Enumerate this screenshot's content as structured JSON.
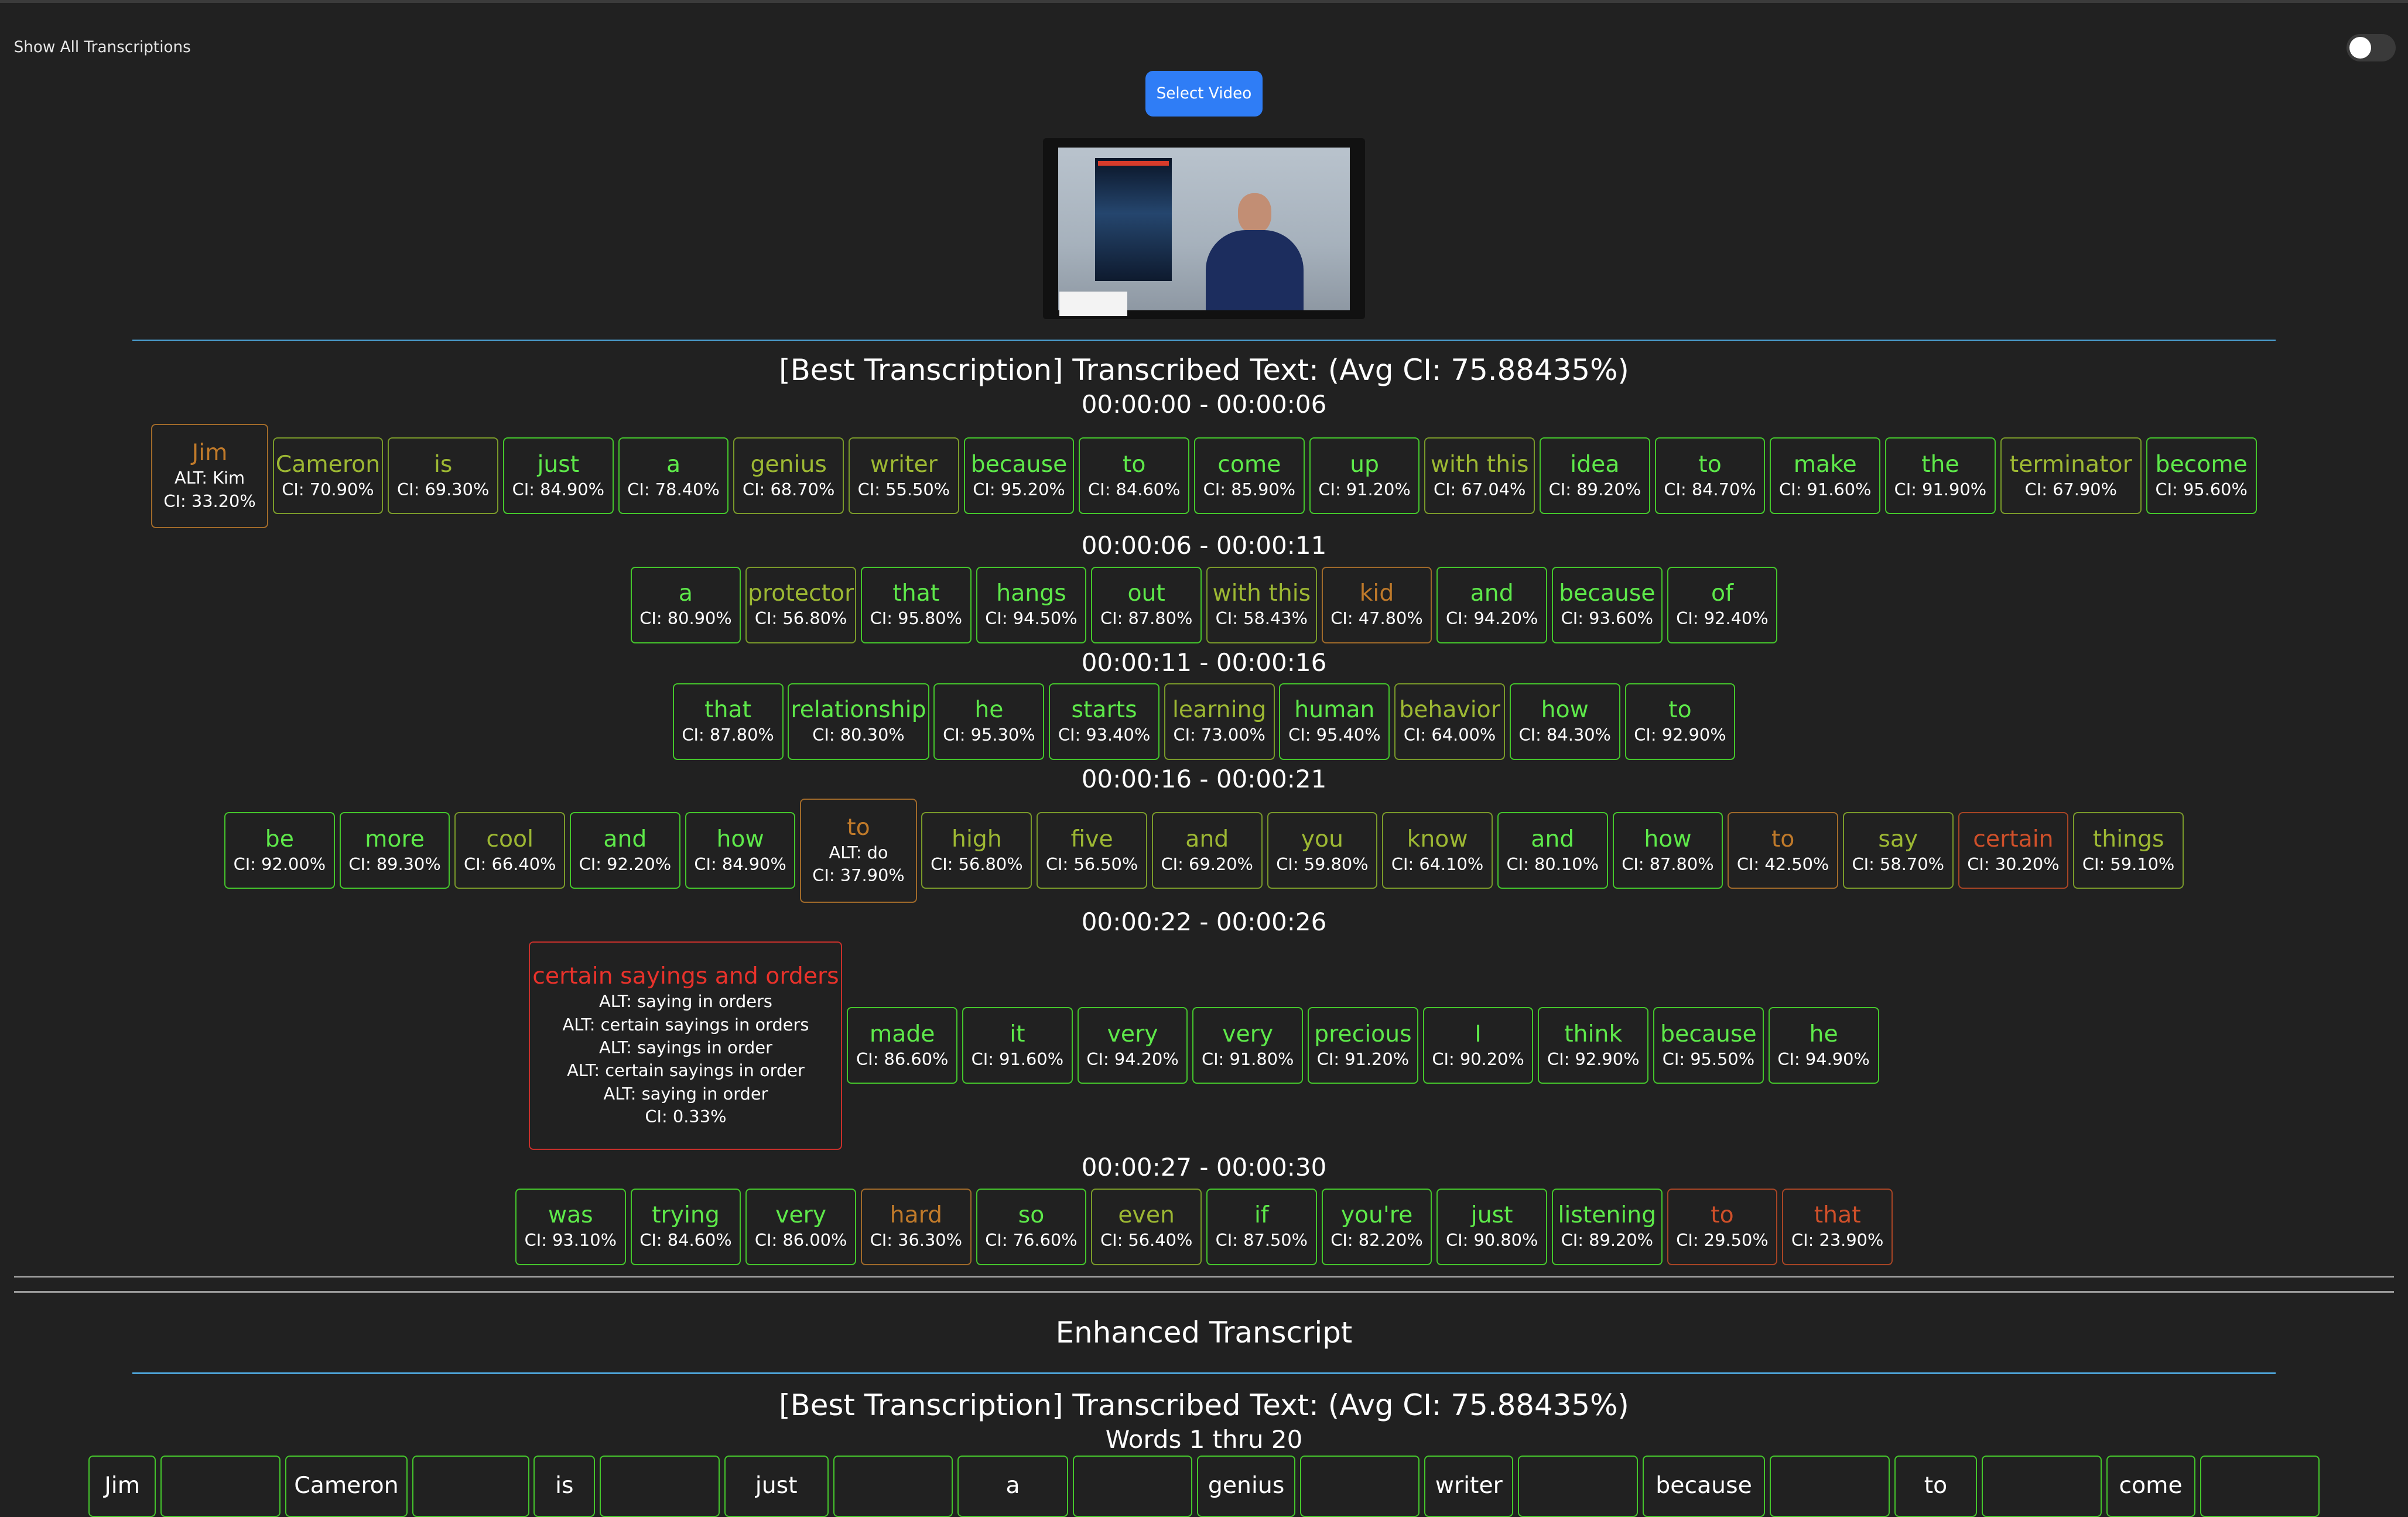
{
  "header": {
    "toggle_label": "Show All Transcriptions",
    "select_button": "Select Video"
  },
  "colors": {
    "high": "#5ee94a",
    "mid": "#9db833",
    "low": "#c07a2a",
    "lower": "#d0502a",
    "lowest": "#e8322b",
    "accent": "#2f7df6",
    "rule": "#4da3d6"
  },
  "best": {
    "heading": "[Best Transcription] Transcribed Text: (Avg CI: 75.88435%)",
    "segments": [
      {
        "range": "00:00:00 - 00:00:06",
        "words": [
          {
            "w": "Jim",
            "ci": "CI: 33.20%",
            "alts": [
              "ALT: Kim"
            ],
            "tone": "g3"
          },
          {
            "w": "Cameron",
            "ci": "CI: 70.90%",
            "tone": "g2"
          },
          {
            "w": "is",
            "ci": "CI: 69.30%",
            "tone": "g2"
          },
          {
            "w": "just",
            "ci": "CI: 84.90%",
            "tone": "g1"
          },
          {
            "w": "a",
            "ci": "CI: 78.40%",
            "tone": "g1"
          },
          {
            "w": "genius",
            "ci": "CI: 68.70%",
            "tone": "g2"
          },
          {
            "w": "writer",
            "ci": "CI: 55.50%",
            "tone": "g2"
          },
          {
            "w": "because",
            "ci": "CI: 95.20%",
            "tone": "g1"
          },
          {
            "w": "to",
            "ci": "CI: 84.60%",
            "tone": "g1"
          },
          {
            "w": "come",
            "ci": "CI: 85.90%",
            "tone": "g1"
          },
          {
            "w": "up",
            "ci": "CI: 91.20%",
            "tone": "g1"
          },
          {
            "w": "with this",
            "ci": "CI: 67.04%",
            "tone": "g2"
          },
          {
            "w": "idea",
            "ci": "CI: 89.20%",
            "tone": "g1"
          },
          {
            "w": "to",
            "ci": "CI: 84.70%",
            "tone": "g1"
          },
          {
            "w": "make",
            "ci": "CI: 91.60%",
            "tone": "g1"
          },
          {
            "w": "the",
            "ci": "CI: 91.90%",
            "tone": "g1"
          },
          {
            "w": "terminator",
            "ci": "CI: 67.90%",
            "tone": "g2",
            "wide": true
          },
          {
            "w": "become",
            "ci": "CI: 95.60%",
            "tone": "g1"
          }
        ]
      },
      {
        "range": "00:00:06 - 00:00:11",
        "words": [
          {
            "w": "a",
            "ci": "CI: 80.90%",
            "tone": "g1"
          },
          {
            "w": "protector",
            "ci": "CI: 56.80%",
            "tone": "g2"
          },
          {
            "w": "that",
            "ci": "CI: 95.80%",
            "tone": "g1"
          },
          {
            "w": "hangs",
            "ci": "CI: 94.50%",
            "tone": "g1"
          },
          {
            "w": "out",
            "ci": "CI: 87.80%",
            "tone": "g1"
          },
          {
            "w": "with this",
            "ci": "CI: 58.43%",
            "tone": "g2"
          },
          {
            "w": "kid",
            "ci": "CI: 47.80%",
            "tone": "g3"
          },
          {
            "w": "and",
            "ci": "CI: 94.20%",
            "tone": "g1"
          },
          {
            "w": "because",
            "ci": "CI: 93.60%",
            "tone": "g1"
          },
          {
            "w": "of",
            "ci": "CI: 92.40%",
            "tone": "g1"
          }
        ]
      },
      {
        "range": "00:00:11 - 00:00:16",
        "words": [
          {
            "w": "that",
            "ci": "CI: 87.80%",
            "tone": "g1"
          },
          {
            "w": "relationship",
            "ci": "CI: 80.30%",
            "tone": "g1",
            "wide": true
          },
          {
            "w": "he",
            "ci": "CI: 95.30%",
            "tone": "g1"
          },
          {
            "w": "starts",
            "ci": "CI: 93.40%",
            "tone": "g1"
          },
          {
            "w": "learning",
            "ci": "CI: 73.00%",
            "tone": "g2"
          },
          {
            "w": "human",
            "ci": "CI: 95.40%",
            "tone": "g1"
          },
          {
            "w": "behavior",
            "ci": "CI: 64.00%",
            "tone": "g2"
          },
          {
            "w": "how",
            "ci": "CI: 84.30%",
            "tone": "g1"
          },
          {
            "w": "to",
            "ci": "CI: 92.90%",
            "tone": "g1"
          }
        ]
      },
      {
        "range": "00:00:16 - 00:00:21",
        "words": [
          {
            "w": "be",
            "ci": "CI: 92.00%",
            "tone": "g1"
          },
          {
            "w": "more",
            "ci": "CI: 89.30%",
            "tone": "g1"
          },
          {
            "w": "cool",
            "ci": "CI: 66.40%",
            "tone": "g2"
          },
          {
            "w": "and",
            "ci": "CI: 92.20%",
            "tone": "g1"
          },
          {
            "w": "how",
            "ci": "CI: 84.90%",
            "tone": "g1"
          },
          {
            "w": "to",
            "ci": "CI: 37.90%",
            "alts": [
              "ALT: do"
            ],
            "tone": "g3"
          },
          {
            "w": "high",
            "ci": "CI: 56.80%",
            "tone": "g2"
          },
          {
            "w": "five",
            "ci": "CI: 56.50%",
            "tone": "g2"
          },
          {
            "w": "and",
            "ci": "CI: 69.20%",
            "tone": "g2"
          },
          {
            "w": "you",
            "ci": "CI: 59.80%",
            "tone": "g2"
          },
          {
            "w": "know",
            "ci": "CI: 64.10%",
            "tone": "g2"
          },
          {
            "w": "and",
            "ci": "CI: 80.10%",
            "tone": "g1"
          },
          {
            "w": "how",
            "ci": "CI: 87.80%",
            "tone": "g1"
          },
          {
            "w": "to",
            "ci": "CI: 42.50%",
            "tone": "g3"
          },
          {
            "w": "say",
            "ci": "CI: 58.70%",
            "tone": "g2"
          },
          {
            "w": "certain",
            "ci": "CI: 30.20%",
            "tone": "g4"
          },
          {
            "w": "things",
            "ci": "CI: 59.10%",
            "tone": "g2"
          }
        ]
      },
      {
        "range": "00:00:22 - 00:00:26",
        "words": [
          {
            "w": "certain sayings and orders",
            "ci": "CI: 0.33%",
            "alts": [
              "ALT: saying in orders",
              "ALT: certain sayings in orders",
              "ALT: sayings in order",
              "ALT: certain sayings in order",
              "ALT: saying in order"
            ],
            "tone": "g5"
          },
          {
            "w": "made",
            "ci": "CI: 86.60%",
            "tone": "g1"
          },
          {
            "w": "it",
            "ci": "CI: 91.60%",
            "tone": "g1"
          },
          {
            "w": "very",
            "ci": "CI: 94.20%",
            "tone": "g1"
          },
          {
            "w": "very",
            "ci": "CI: 91.80%",
            "tone": "g1"
          },
          {
            "w": "precious",
            "ci": "CI: 91.20%",
            "tone": "g1"
          },
          {
            "w": "I",
            "ci": "CI: 90.20%",
            "tone": "g1"
          },
          {
            "w": "think",
            "ci": "CI: 92.90%",
            "tone": "g1"
          },
          {
            "w": "because",
            "ci": "CI: 95.50%",
            "tone": "g1"
          },
          {
            "w": "he",
            "ci": "CI: 94.90%",
            "tone": "g1"
          }
        ]
      },
      {
        "range": "00:00:27 - 00:00:30",
        "words": [
          {
            "w": "was",
            "ci": "CI: 93.10%",
            "tone": "g1"
          },
          {
            "w": "trying",
            "ci": "CI: 84.60%",
            "tone": "g1"
          },
          {
            "w": "very",
            "ci": "CI: 86.00%",
            "tone": "g1"
          },
          {
            "w": "hard",
            "ci": "CI: 36.30%",
            "tone": "g3"
          },
          {
            "w": "so",
            "ci": "CI: 76.60%",
            "tone": "g1"
          },
          {
            "w": "even",
            "ci": "CI: 56.40%",
            "tone": "g2"
          },
          {
            "w": "if",
            "ci": "CI: 87.50%",
            "tone": "g1"
          },
          {
            "w": "you're",
            "ci": "CI: 82.20%",
            "tone": "g1"
          },
          {
            "w": "just",
            "ci": "CI: 90.80%",
            "tone": "g1"
          },
          {
            "w": "listening",
            "ci": "CI: 89.20%",
            "tone": "g1"
          },
          {
            "w": "to",
            "ci": "CI: 29.50%",
            "tone": "g4"
          },
          {
            "w": "that",
            "ci": "CI: 23.90%",
            "tone": "g4"
          }
        ]
      }
    ]
  },
  "enhanced": {
    "title": "Enhanced Transcript",
    "heading": "[Best Transcription] Transcribed Text: (Avg CI: 75.88435%)",
    "range": "Words 1 thru 20",
    "tiles": [
      "Jim",
      "",
      "Cameron",
      "",
      "is",
      "",
      "just",
      "",
      "a",
      "",
      "genius",
      "",
      "writer",
      "",
      "because",
      "",
      "to",
      "",
      "come",
      ""
    ],
    "tile_widths": [
      44,
      78,
      80,
      76,
      40,
      78,
      68,
      78,
      72,
      78,
      64,
      78,
      58,
      78,
      80,
      78,
      54,
      78,
      58,
      78
    ]
  }
}
